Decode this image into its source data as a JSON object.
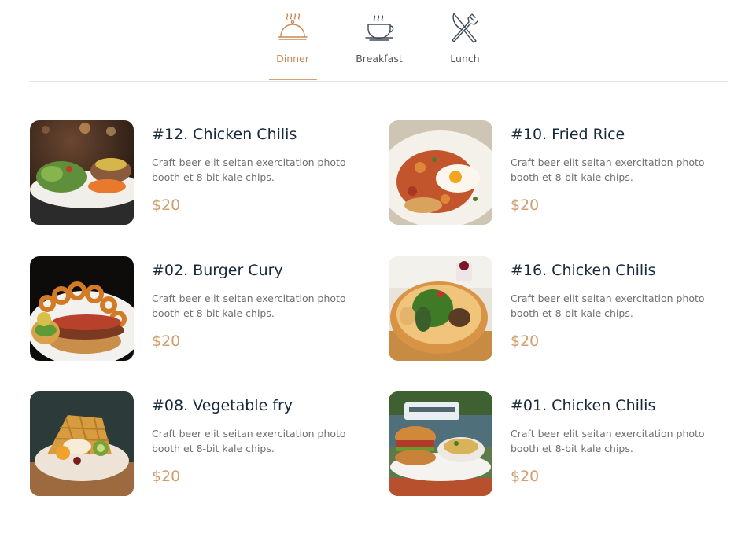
{
  "tabs": [
    {
      "label": "Dinner",
      "icon": "cloche-icon",
      "active": true
    },
    {
      "label": "Breakfast",
      "icon": "coffee-cup-icon",
      "active": false
    },
    {
      "label": "Lunch",
      "icon": "fork-knife-icon",
      "active": false
    }
  ],
  "colors": {
    "accent": "#d29d6d",
    "title": "#17293a",
    "text": "#707070"
  },
  "menu": [
    {
      "title": "#12. Chicken Chilis",
      "desc": "Craft beer elit seitan exercitation photo booth et 8-bit kale chips.",
      "price": "$20",
      "image": "steak-salad-plate"
    },
    {
      "title": "#10. Fried Rice",
      "desc": "Craft beer elit seitan exercitation photo booth et 8-bit kale chips.",
      "price": "$20",
      "image": "eggs-on-toast"
    },
    {
      "title": "#02. Burger Cury",
      "desc": "Craft beer elit seitan exercitation photo booth et 8-bit kale chips.",
      "price": "$20",
      "image": "burger-onion-rings"
    },
    {
      "title": "#16. Chicken Chilis",
      "desc": "Craft beer elit seitan exercitation photo booth et 8-bit kale chips.",
      "price": "$20",
      "image": "salad-bowl"
    },
    {
      "title": "#08. Vegetable fry",
      "desc": "Craft beer elit seitan exercitation photo booth et 8-bit kale chips.",
      "price": "$20",
      "image": "waffle-fruit"
    },
    {
      "title": "#01. Chicken Chilis",
      "desc": "Craft beer elit seitan exercitation photo booth et 8-bit kale chips.",
      "price": "$20",
      "image": "burger-boat"
    }
  ]
}
